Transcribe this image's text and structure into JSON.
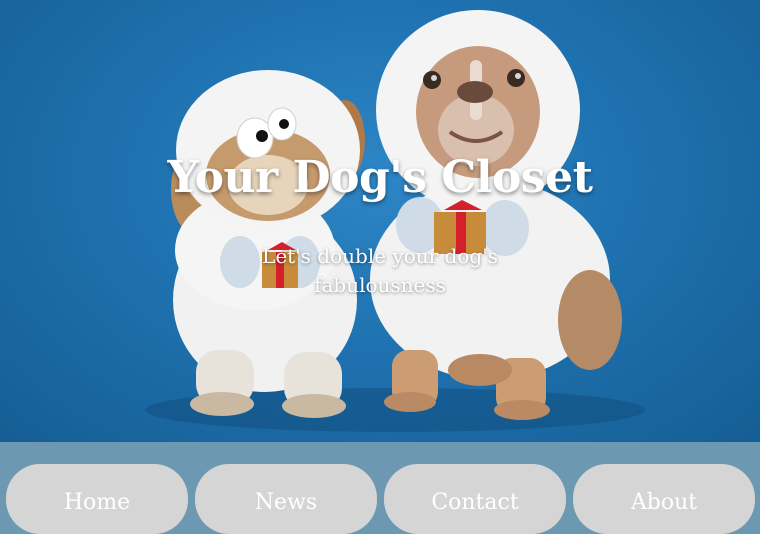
{
  "hero": {
    "title": "Your Dog's Closet",
    "subtitle": "Let's double your dog's fabulousness",
    "image": "two-dogs-in-white-fluffy-costumes-photo"
  },
  "nav": {
    "items": [
      {
        "label": "Home"
      },
      {
        "label": "News"
      },
      {
        "label": "Contact"
      },
      {
        "label": "About"
      }
    ]
  },
  "colors": {
    "hero_background": "#1f72b0",
    "nav_background": "#6c98b2",
    "button_background": "#d5d5d5",
    "text": "#ffffff"
  }
}
